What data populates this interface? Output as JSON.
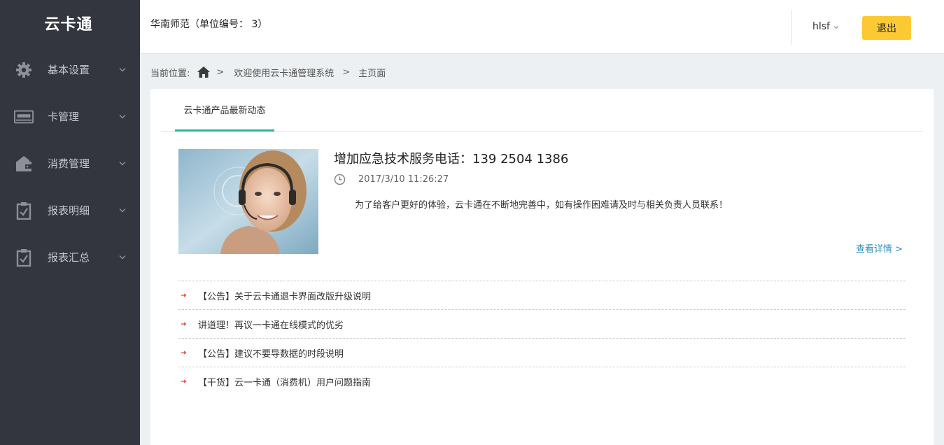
{
  "app": {
    "logo_text": "云卡通"
  },
  "sidebar": {
    "items": [
      {
        "label": "基本设置",
        "icon": "gear-icon"
      },
      {
        "label": "卡管理",
        "icon": "card-icon"
      },
      {
        "label": "消费管理",
        "icon": "wallet-icon"
      },
      {
        "label": "报表明细",
        "icon": "clipboard-check-icon"
      },
      {
        "label": "报表汇总",
        "icon": "clipboard-check-icon"
      }
    ]
  },
  "header": {
    "org_text": "华南师范（单位编号： 3）",
    "username": "hlsf",
    "logout_label": "退出"
  },
  "breadcrumb": {
    "prefix": "当前位置:",
    "crumb1": "欢迎使用云卡通管理系统",
    "crumb2": "主页面",
    "separator": ">"
  },
  "main": {
    "tab_label": "云卡通产品最新动态",
    "featured": {
      "title": "增加应急技术服务电话：139 2504 1386",
      "date": "2017/3/10 11:26:27",
      "description": "为了给客户更好的体验，云卡通在不断地完善中，如有操作困难请及时与相关负责人员联系！",
      "more_label": "查看详情 >"
    },
    "news": [
      {
        "title": "【公告】关于云卡通退卡界面改版升级说明"
      },
      {
        "title": "讲道理！再议一卡通在线模式的优劣"
      },
      {
        "title": "【公告】建议不要导数据的时段说明"
      },
      {
        "title": "【干货】云一卡通（消费机）用户问题指南"
      }
    ]
  },
  "colors": {
    "sidebar_bg": "#33363f",
    "accent_teal": "#2bb3a5",
    "logout_yellow": "#fbc934",
    "link_blue": "#2a8fb8",
    "arrow_red": "#e0483e"
  }
}
